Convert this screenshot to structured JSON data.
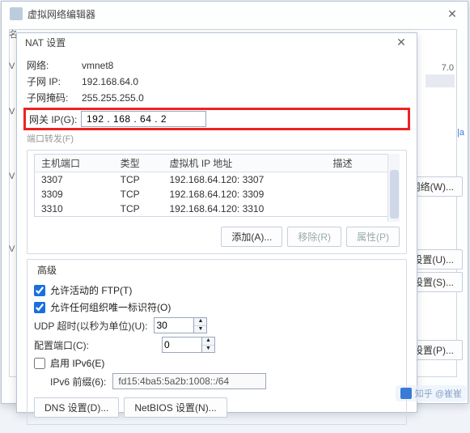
{
  "parent_window": {
    "title": "虚拟网络编辑器",
    "truncated_right_value": "7.0",
    "right_buttons": {
      "rename": "命名网络(W)...",
      "auto_settings": "动设置(U)...",
      "nat_settings": "T 设置(S)...",
      "cp_settings": "CP 设置(P)..."
    },
    "side_letters": [
      "名",
      "V",
      "V",
      "V",
      "V"
    ],
    "side_cn": "|a"
  },
  "nat_dialog": {
    "title": "NAT 设置",
    "network_label": "网络:",
    "network_value": "vmnet8",
    "subnet_ip_label": "子网 IP:",
    "subnet_ip_value": "192.168.64.0",
    "subnet_mask_label": "子网掩码:",
    "subnet_mask_value": "255.255.255.0",
    "gateway_label": "网关 IP(G):",
    "gateway_value": "192 . 168 . 64 . 2",
    "pf_faint": "端口转发(F)",
    "pf_headers": [
      "主机端口",
      "类型",
      "虚拟机 IP 地址",
      "描述"
    ],
    "pf_rows": [
      {
        "host_port": "3307",
        "type": "TCP",
        "vm": "192.168.64.120: 3307",
        "desc": ""
      },
      {
        "host_port": "3309",
        "type": "TCP",
        "vm": "192.168.64.120: 3309",
        "desc": ""
      },
      {
        "host_port": "3310",
        "type": "TCP",
        "vm": "192.168.64.120: 3310",
        "desc": ""
      }
    ],
    "btn_add": "添加(A)...",
    "btn_remove": "移除(R)",
    "btn_props": "属性(P)",
    "adv_title": "高级",
    "chk_ftp": "允许活动的 FTP(T)",
    "chk_org": "允许任何组织唯一标识符(O)",
    "udp_label": "UDP 超时(以秒为单位)(U):",
    "udp_value": "30",
    "cfg_port_label": "配置端口(C):",
    "cfg_port_value": "0",
    "chk_ipv6": "启用 IPv6(E)",
    "ipv6_prefix_label": "IPv6 前缀(6):",
    "ipv6_prefix_value": "fd15:4ba5:5a2b:1008::/64",
    "btn_dns": "DNS 设置(D)...",
    "btn_netbios": "NetBIOS 设置(N)..."
  },
  "watermark": "知乎 @崔崔"
}
